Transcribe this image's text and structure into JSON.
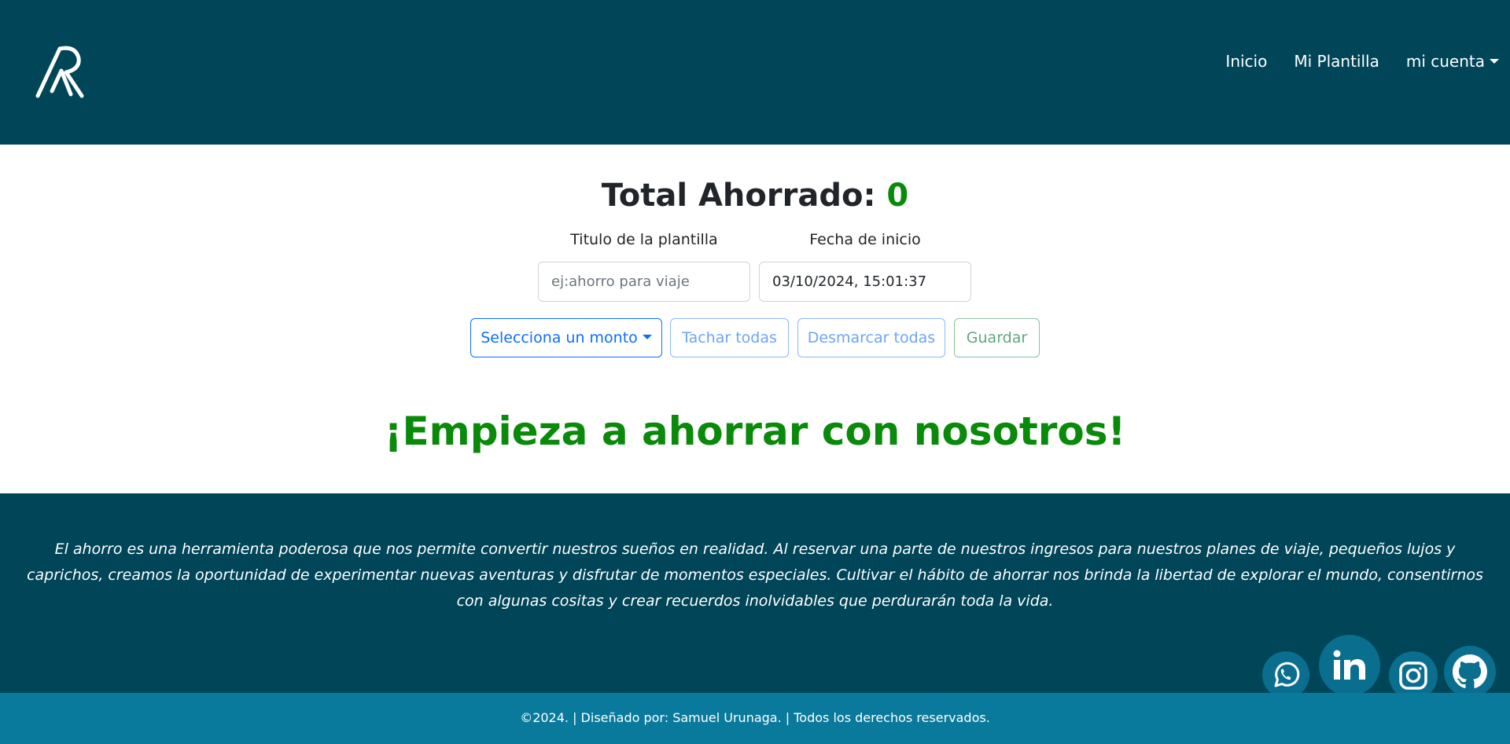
{
  "nav": {
    "logo_icon": "ar-logo-icon",
    "links": [
      "Inicio",
      "Mi Plantilla",
      "mi cuenta"
    ]
  },
  "main": {
    "total_label": "Total Ahorrado:",
    "total_value": "0",
    "title_label": "Titulo de la plantilla",
    "title_placeholder": "ej:ahorro para viaje",
    "date_label": "Fecha de inicio",
    "date_value": "03/10/2024, 15:01:37",
    "buttons": {
      "select": "Selecciona un monto",
      "tachar": "Tachar todas",
      "desmarcar": "Desmarcar todas",
      "guardar": "Guardar"
    },
    "headline": "¡Empieza a ahorrar con nosotros!"
  },
  "footer": {
    "quote": "El ahorro es una herramienta poderosa que nos permite convertir nuestros sueños en realidad. Al reservar una parte de nuestros ingresos para nuestros planes de viaje, pequeños lujos y caprichos, creamos la oportunidad de experimentar nuevas aventuras y disfrutar de momentos especiales. Cultivar el hábito de ahorrar nos brinda la libertad de explorar el mundo, consentirnos con algunas cositas y crear recuerdos inolvidables que perdurarán toda la vida.",
    "social": [
      "whatsapp-icon",
      "linkedin-icon",
      "instagram-icon",
      "github-icon"
    ],
    "copyright": "©2024. | Diseñado por: Samuel Urunaga. | Todos los derechos reservados."
  },
  "colors": {
    "navbar_bg": "#004658",
    "footer_bottom_bg": "#0a7a9c",
    "accent_green": "#0a8a0a",
    "primary_blue": "#0d6efd"
  }
}
